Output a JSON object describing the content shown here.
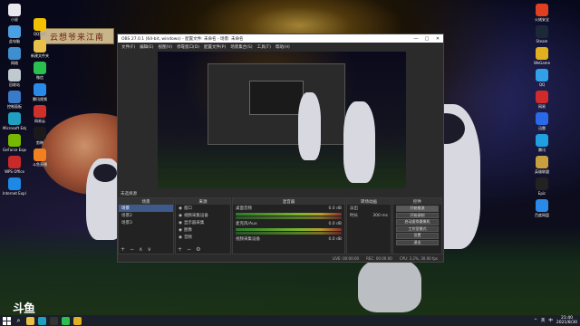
{
  "desktop": {
    "banner": "云想爷来江南",
    "left_icons": [
      {
        "label": "小说",
        "color": "#e8e8ee"
      },
      {
        "label": "此电脑",
        "color": "#4aa0e0"
      },
      {
        "label": "网络",
        "color": "#3d8fd0"
      },
      {
        "label": "回收站",
        "color": "#c0c8d0"
      },
      {
        "label": "控制面板",
        "color": "#3a7ac8"
      },
      {
        "label": "Microsoft Edge",
        "color": "#1fa0c0"
      },
      {
        "label": "GeForce Experience",
        "color": "#76b900"
      },
      {
        "label": "WPS Office",
        "color": "#c82a2a"
      },
      {
        "label": "Internet Explorer",
        "color": "#1e88e5"
      }
    ],
    "second_icons": [
      {
        "label": "QQ音乐",
        "color": "#f2c200"
      },
      {
        "label": "新建文件夹",
        "color": "#e8c04a"
      },
      {
        "label": "微信",
        "color": "#2ac050"
      },
      {
        "label": "腾讯视频",
        "color": "#2a8ae8"
      },
      {
        "label": "网易云",
        "color": "#d0302a"
      },
      {
        "label": "剪映",
        "color": "#1a1a1a"
      },
      {
        "label": "斗鱼直播",
        "color": "#f08020"
      }
    ],
    "right_icons": [
      {
        "label": "火绒安全",
        "color": "#e04020"
      },
      {
        "label": "Steam",
        "color": "#1b2838"
      },
      {
        "label": "WeGame",
        "color": "#e0b020"
      },
      {
        "label": "QQ",
        "color": "#30a0e8"
      },
      {
        "label": "网易",
        "color": "#d02a2a"
      },
      {
        "label": "迅雷",
        "color": "#2a6ae8"
      },
      {
        "label": "腾讯",
        "color": "#20a0e0"
      },
      {
        "label": "英雄联盟",
        "color": "#c8a040"
      },
      {
        "label": "Epic",
        "color": "#222"
      },
      {
        "label": "百度网盘",
        "color": "#2a8ae8"
      }
    ],
    "douyu_logo": "斗鱼"
  },
  "obs": {
    "title": "OBS 27.0.1 (64-bit, windows) - 配置文件: 未命名 - 场景: 未命名",
    "window_controls": [
      "—",
      "□",
      "✕"
    ],
    "menu": [
      "文件(F)",
      "编辑(E)",
      "视图(V)",
      "停靠窗口(D)",
      "配置文件(P)",
      "场景集合(S)",
      "工具(T)",
      "帮助(H)"
    ],
    "scene_bar_label": "未选择源",
    "docks": {
      "scenes": {
        "title": "场景",
        "items": [
          "场景",
          "场景2",
          "场景3"
        ],
        "selected": 0
      },
      "sources": {
        "title": "来源",
        "items": [
          "窗口",
          "视频采集设备",
          "显示器采集",
          "图像",
          "音频"
        ]
      },
      "mixer": {
        "title": "混音器",
        "channels": [
          {
            "name": "桌面音频",
            "db": "0.0 dB"
          },
          {
            "name": "麦克风/Aux",
            "db": "0.0 dB"
          },
          {
            "name": "视频采集设备",
            "db": "0.0 dB"
          }
        ]
      },
      "transitions": {
        "title": "转场动画",
        "mode": "淡出",
        "duration_label": "时长",
        "duration": "300 ms"
      },
      "controls": {
        "title": "控件",
        "buttons": [
          "开始推流",
          "开始录制",
          "启动虚拟摄像机",
          "工作室模式",
          "设置",
          "退出"
        ]
      }
    },
    "status": [
      "LIVE: 00:00:00",
      "REC: 00:00:00",
      "CPU: 3.2%, 30.00 fps"
    ]
  },
  "taskbar": {
    "apps": [
      {
        "name": "file-explorer",
        "color": "#e8c04a"
      },
      {
        "name": "edge",
        "color": "#1fa0c0"
      },
      {
        "name": "obs",
        "color": "#333"
      },
      {
        "name": "wechat",
        "color": "#2ac050"
      },
      {
        "name": "chrome",
        "color": "#e0b020"
      }
    ],
    "tray": [
      "^",
      "英",
      "中"
    ],
    "time": "21:40",
    "date": "2021/8/30"
  }
}
